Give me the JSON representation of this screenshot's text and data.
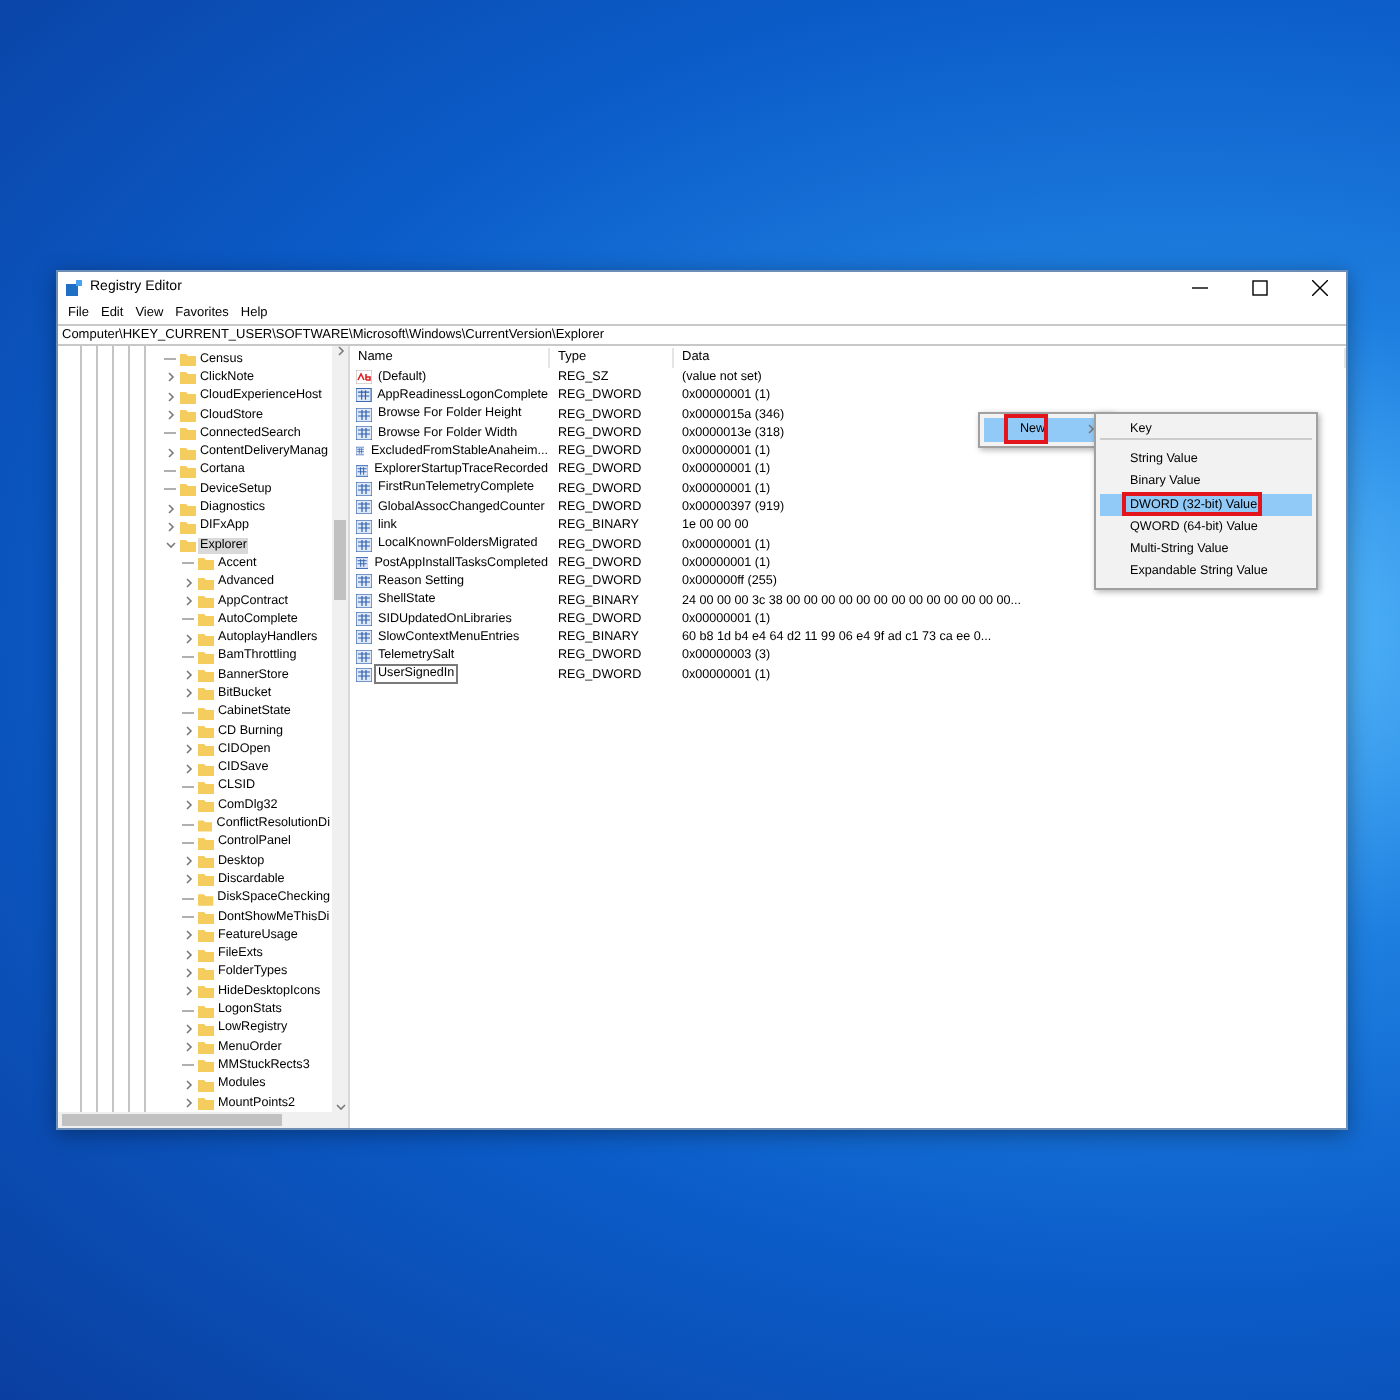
{
  "window": {
    "title": "Registry Editor"
  },
  "menu_bar": [
    "File",
    "Edit",
    "View",
    "Favorites",
    "Help"
  ],
  "address": "Computer\\HKEY_CURRENT_USER\\SOFTWARE\\Microsoft\\Windows\\CurrentVersion\\Explorer",
  "tree": [
    {
      "label": "Census",
      "kind": "leaf",
      "selected": false
    },
    {
      "label": "ClickNote",
      "kind": "branch",
      "selected": false
    },
    {
      "label": "CloudExperienceHost",
      "kind": "branch",
      "selected": false
    },
    {
      "label": "CloudStore",
      "kind": "branch",
      "selected": false
    },
    {
      "label": "ConnectedSearch",
      "kind": "leaf",
      "selected": false
    },
    {
      "label": "ContentDeliveryManag",
      "kind": "branch",
      "selected": false
    },
    {
      "label": "Cortana",
      "kind": "leaf",
      "selected": false
    },
    {
      "label": "DeviceSetup",
      "kind": "leaf",
      "selected": false
    },
    {
      "label": "Diagnostics",
      "kind": "branch",
      "selected": false
    },
    {
      "label": "DIFxApp",
      "kind": "branch",
      "selected": false
    },
    {
      "label": "Explorer",
      "kind": "open",
      "selected": true,
      "children": [
        {
          "label": "Accent",
          "kind": "leaf",
          "selected": false
        },
        {
          "label": "Advanced",
          "kind": "branch",
          "selected": false
        },
        {
          "label": "AppContract",
          "kind": "branch",
          "selected": false
        },
        {
          "label": "AutoComplete",
          "kind": "leaf",
          "selected": false
        },
        {
          "label": "AutoplayHandlers",
          "kind": "branch",
          "selected": false
        },
        {
          "label": "BamThrottling",
          "kind": "leaf",
          "selected": false
        },
        {
          "label": "BannerStore",
          "kind": "branch",
          "selected": false
        },
        {
          "label": "BitBucket",
          "kind": "branch",
          "selected": false
        },
        {
          "label": "CabinetState",
          "kind": "leaf",
          "selected": false
        },
        {
          "label": "CD Burning",
          "kind": "branch",
          "selected": false
        },
        {
          "label": "CIDOpen",
          "kind": "branch",
          "selected": false
        },
        {
          "label": "CIDSave",
          "kind": "branch",
          "selected": false
        },
        {
          "label": "CLSID",
          "kind": "leaf",
          "selected": false
        },
        {
          "label": "ComDlg32",
          "kind": "branch",
          "selected": false
        },
        {
          "label": "ConflictResolutionDi",
          "kind": "leaf",
          "selected": false
        },
        {
          "label": "ControlPanel",
          "kind": "leaf",
          "selected": false
        },
        {
          "label": "Desktop",
          "kind": "branch",
          "selected": false
        },
        {
          "label": "Discardable",
          "kind": "branch",
          "selected": false
        },
        {
          "label": "DiskSpaceChecking",
          "kind": "leaf",
          "selected": false
        },
        {
          "label": "DontShowMeThisDi",
          "kind": "leaf",
          "selected": false
        },
        {
          "label": "FeatureUsage",
          "kind": "branch",
          "selected": false
        },
        {
          "label": "FileExts",
          "kind": "branch",
          "selected": false
        },
        {
          "label": "FolderTypes",
          "kind": "branch",
          "selected": false
        },
        {
          "label": "HideDesktopIcons",
          "kind": "branch",
          "selected": false
        },
        {
          "label": "LogonStats",
          "kind": "leaf",
          "selected": false
        },
        {
          "label": "LowRegistry",
          "kind": "branch",
          "selected": false
        },
        {
          "label": "MenuOrder",
          "kind": "branch",
          "selected": false
        },
        {
          "label": "MMStuckRects3",
          "kind": "leaf",
          "selected": false
        },
        {
          "label": "Modules",
          "kind": "branch",
          "selected": false
        },
        {
          "label": "MountPoints2",
          "kind": "branch",
          "selected": false
        }
      ]
    }
  ],
  "values": {
    "columns": [
      "Name",
      "Type",
      "Data"
    ],
    "rows": [
      {
        "kind": "string",
        "name": "(Default)",
        "type": "REG_SZ",
        "data": "(value not set)",
        "editing": false
      },
      {
        "kind": "binary",
        "name": "AppReadinessLogonComplete",
        "type": "REG_DWORD",
        "data": "0x00000001 (1)",
        "editing": false
      },
      {
        "kind": "binary",
        "name": "Browse For Folder Height",
        "type": "REG_DWORD",
        "data": "0x0000015a (346)",
        "editing": false
      },
      {
        "kind": "binary",
        "name": "Browse For Folder Width",
        "type": "REG_DWORD",
        "data": "0x0000013e (318)",
        "editing": false
      },
      {
        "kind": "binary",
        "name": "ExcludedFromStableAnaheim...",
        "type": "REG_DWORD",
        "data": "0x00000001 (1)",
        "editing": false
      },
      {
        "kind": "binary",
        "name": "ExplorerStartupTraceRecorded",
        "type": "REG_DWORD",
        "data": "0x00000001 (1)",
        "editing": false
      },
      {
        "kind": "binary",
        "name": "FirstRunTelemetryComplete",
        "type": "REG_DWORD",
        "data": "0x00000001 (1)",
        "editing": false
      },
      {
        "kind": "binary",
        "name": "GlobalAssocChangedCounter",
        "type": "REG_DWORD",
        "data": "0x00000397 (919)",
        "editing": false
      },
      {
        "kind": "binary",
        "name": "link",
        "type": "REG_BINARY",
        "data": "1e 00 00 00",
        "editing": false
      },
      {
        "kind": "binary",
        "name": "LocalKnownFoldersMigrated",
        "type": "REG_DWORD",
        "data": "0x00000001 (1)",
        "editing": false
      },
      {
        "kind": "binary",
        "name": "PostAppInstallTasksCompleted",
        "type": "REG_DWORD",
        "data": "0x00000001 (1)",
        "editing": false
      },
      {
        "kind": "binary",
        "name": "Reason Setting",
        "type": "REG_DWORD",
        "data": "0x000000ff (255)",
        "editing": false
      },
      {
        "kind": "binary",
        "name": "ShellState",
        "type": "REG_BINARY",
        "data": "24 00 00 00 3c 38 00 00 00 00 00 00 00 00 00 00 00 00 00...",
        "editing": false
      },
      {
        "kind": "binary",
        "name": "SIDUpdatedOnLibraries",
        "type": "REG_DWORD",
        "data": "0x00000001 (1)",
        "editing": false
      },
      {
        "kind": "binary",
        "name": "SlowContextMenuEntries",
        "type": "REG_BINARY",
        "data": "60 b8 1d b4 e4 64 d2 11 99 06 e4 9f ad c1 73 ca ee 0...",
        "editing": false
      },
      {
        "kind": "binary",
        "name": "TelemetrySalt",
        "type": "REG_DWORD",
        "data": "0x00000003 (3)",
        "editing": false
      },
      {
        "kind": "binary",
        "name": "UserSignedIn",
        "type": "REG_DWORD",
        "data": "0x00000001 (1)",
        "editing": true
      }
    ]
  },
  "context_menu": {
    "items": [
      {
        "label": "New",
        "has_submenu": true,
        "selected": true,
        "outlined": true
      }
    ]
  },
  "submenu": {
    "items": [
      {
        "label": "Key",
        "selected": false,
        "outlined": false,
        "separator_after": true
      },
      {
        "label": "String Value",
        "selected": false,
        "outlined": false,
        "separator_after": false
      },
      {
        "label": "Binary Value",
        "selected": false,
        "outlined": false,
        "separator_after": false
      },
      {
        "label": "DWORD (32-bit) Value",
        "selected": true,
        "outlined": true,
        "separator_after": false
      },
      {
        "label": "QWORD (64-bit) Value",
        "selected": false,
        "outlined": false,
        "separator_after": false
      },
      {
        "label": "Multi-String Value",
        "selected": false,
        "outlined": false,
        "separator_after": false
      },
      {
        "label": "Expandable String Value",
        "selected": false,
        "outlined": false,
        "separator_after": false
      }
    ]
  }
}
